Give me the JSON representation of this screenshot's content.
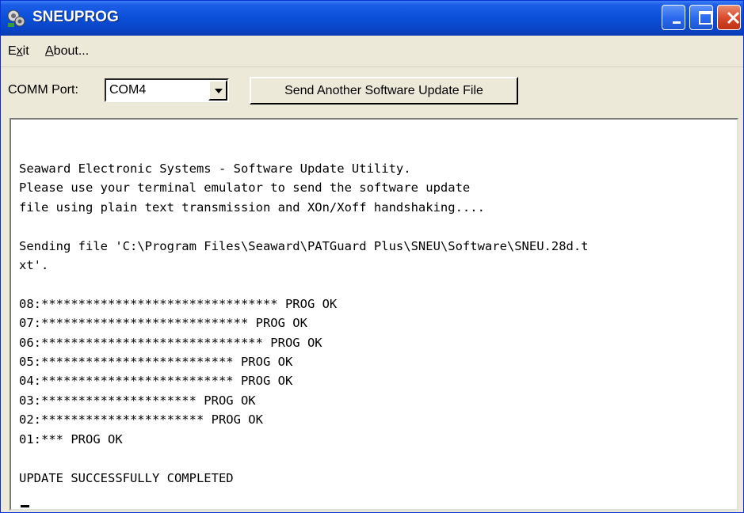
{
  "window": {
    "title": "SNEUPROG"
  },
  "menu": {
    "exit_label": "Exit",
    "about_label": "About..."
  },
  "toolbar": {
    "comm_port_label": "COMM Port:",
    "comm_port_value": "COM4",
    "send_button_label": "Send Another Software Update File"
  },
  "terminal": {
    "lines": [
      "Seaward Electronic Systems - Software Update Utility.",
      "Please use your terminal emulator to send the software update",
      "file using plain text transmission and XOn/Xoff handshaking....",
      "",
      "Sending file 'C:\\Program Files\\Seaward\\PATGuard Plus\\SNEU\\Software\\SNEU.28d.t",
      "xt'.",
      "",
      "08:******************************** PROG OK",
      "07:**************************** PROG OK",
      "06:****************************** PROG OK",
      "05:************************** PROG OK",
      "04:************************** PROG OK",
      "03:********************* PROG OK",
      "02:********************** PROG OK",
      "01:*** PROG OK",
      "",
      "UPDATE SUCCESSFULLY COMPLETED"
    ]
  },
  "colors": {
    "titlebar": "#0a4fd8",
    "window_bg": "#ece9d8",
    "terminal_bg": "#ffffff"
  }
}
